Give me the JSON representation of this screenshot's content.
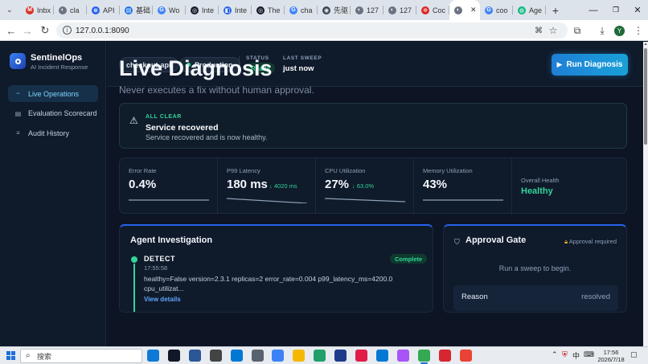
{
  "browser": {
    "tabs": [
      {
        "label": "Inbx",
        "fav_color": "#d93025",
        "fav_glyph": "M"
      },
      {
        "label": "cla",
        "fav_color": "#6b7280",
        "fav_glyph": "◐"
      },
      {
        "label": "API",
        "fav_color": "#2563eb",
        "fav_glyph": "⊛"
      },
      {
        "label": "基础",
        "fav_color": "#1a73e8",
        "fav_glyph": "▤"
      },
      {
        "label": "Wo",
        "fav_color": "#4285f4",
        "fav_glyph": "G"
      },
      {
        "label": "Inte",
        "fav_color": "#111827",
        "fav_glyph": "◎"
      },
      {
        "label": "Inte",
        "fav_color": "#2563eb",
        "fav_glyph": "◧"
      },
      {
        "label": "The",
        "fav_color": "#111827",
        "fav_glyph": "◎"
      },
      {
        "label": "cha",
        "fav_color": "#4285f4",
        "fav_glyph": "G"
      },
      {
        "label": "先驱",
        "fav_color": "#374151",
        "fav_glyph": "◉"
      },
      {
        "label": "127",
        "fav_color": "#6b7280",
        "fav_glyph": "◐"
      },
      {
        "label": "127",
        "fav_color": "#6b7280",
        "fav_glyph": "◐"
      },
      {
        "label": "Coc",
        "fav_color": "#dc2626",
        "fav_glyph": "✲"
      },
      {
        "label": "",
        "fav_color": "#6b7280",
        "fav_glyph": "◐",
        "active": true
      },
      {
        "label": "coo",
        "fav_color": "#4285f4",
        "fav_glyph": "G"
      },
      {
        "label": "Age",
        "fav_color": "#10b981",
        "fav_glyph": "◍"
      }
    ],
    "new_tab": "+",
    "url": "127.0.0.1:8090",
    "window_controls": {
      "minimize": "—",
      "maximize": "❐",
      "close": "✕"
    }
  },
  "app": {
    "brand": "SentinelOps",
    "brand_sub": "AI Incident Response",
    "nav": [
      {
        "label": "Live Operations",
        "icon": "~",
        "active": true
      },
      {
        "label": "Evaluation Scorecard",
        "icon": "▤"
      },
      {
        "label": "Audit History",
        "icon": "≡"
      }
    ],
    "header": {
      "service": "checkout-api",
      "environment": "Production",
      "status_label": "STATUS",
      "status_value": "Ready",
      "sweep_label": "LAST SWEEP",
      "sweep_value": "just now",
      "run_button": "Run Diagnosis",
      "run_icon": "▶"
    },
    "title": "Live Diagnosis",
    "subtitle": "Never executes a fix without human approval.",
    "alert": {
      "tag": "ALL CLEAR",
      "title": "Service recovered",
      "message": "Service recovered and is now healthy.",
      "icon": "⚠"
    },
    "metrics": [
      {
        "label": "Error Rate",
        "value": "0.4%",
        "delta": "",
        "trend": 0.0
      },
      {
        "label": "P99 Latency",
        "value": "180 ms",
        "delta": "↓ 4020 ms",
        "trend": 0.6
      },
      {
        "label": "CPU Utilization",
        "value": "27%",
        "delta": "↓ 63.0%",
        "trend": 0.4
      },
      {
        "label": "Memory Utilization",
        "value": "43%",
        "delta": "",
        "trend": 0.0
      }
    ],
    "overall": {
      "label": "Overall Health",
      "value": "Healthy"
    },
    "investigation": {
      "title": "Agent Investigation",
      "step": {
        "name": "DETECT",
        "time": "17:55:58",
        "badge": "Complete",
        "body_line1": "healthy=False version=2.3.1 replicas=2 error_rate=0.004 p99_latency_ms=4200.0",
        "body_line2": "cpu_utilizat...",
        "link": "View details"
      }
    },
    "approval": {
      "title": "Approval Gate",
      "required": "Approval required",
      "message": "Run a sweep to begin.",
      "reason_label": "Reason",
      "reason_value": "resolved"
    }
  },
  "taskbar": {
    "search_placeholder": "搜索",
    "time": "17:56",
    "date": "2026/7/18",
    "ime": "中",
    "apps": [
      {
        "name": "edge",
        "color": "#0f7ad6"
      },
      {
        "name": "pycharm",
        "color": "#111827"
      },
      {
        "name": "app3",
        "color": "#2b5797"
      },
      {
        "name": "box",
        "color": "#444444"
      },
      {
        "name": "app5",
        "color": "#0078d4"
      },
      {
        "name": "notepad",
        "color": "#5a6270"
      },
      {
        "name": "calendar",
        "color": "#3b82f6"
      },
      {
        "name": "files",
        "color": "#f5b800"
      },
      {
        "name": "app9",
        "color": "#22a06b"
      },
      {
        "name": "app10",
        "color": "#1e3a8a"
      },
      {
        "name": "app11",
        "color": "#e11d48"
      },
      {
        "name": "vscode",
        "color": "#0078d4"
      },
      {
        "name": "app13",
        "color": "#a855f7"
      },
      {
        "name": "chrome",
        "color": "#34a853",
        "active": true
      },
      {
        "name": "wps",
        "color": "#d7262f"
      },
      {
        "name": "chrome2",
        "color": "#ea4335"
      }
    ]
  },
  "colors": {
    "accent": "#1e7fd6",
    "healthy": "#34d399",
    "background": "#0d1424"
  }
}
